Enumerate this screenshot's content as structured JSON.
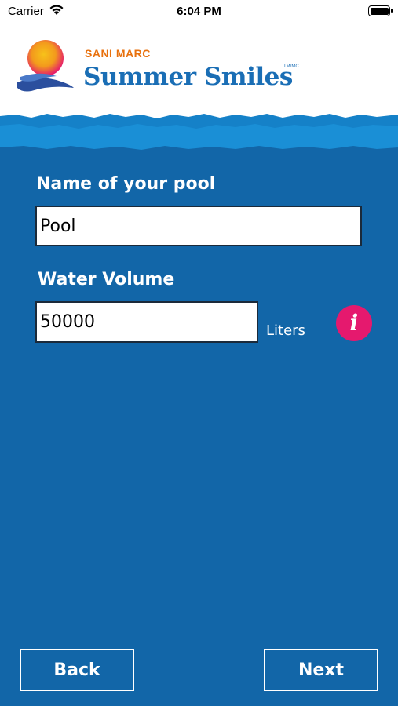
{
  "status_bar": {
    "carrier": "Carrier",
    "time": "6:04 PM"
  },
  "brand": {
    "company": "SANI MARC",
    "product": "Summer Smiles",
    "trademark": "TM/MC"
  },
  "form": {
    "pool_name_label": "Name of your pool",
    "pool_name_value": "Pool",
    "water_volume_label": "Water Volume",
    "water_volume_value": "50000",
    "water_volume_unit": "Liters",
    "info_icon": "info-icon"
  },
  "footer": {
    "back_label": "Back",
    "next_label": "Next"
  },
  "colors": {
    "background": "#1266a8",
    "brand_orange": "#e8710e",
    "brand_blue": "#1a6eb5",
    "info_pink": "#e5196e"
  }
}
